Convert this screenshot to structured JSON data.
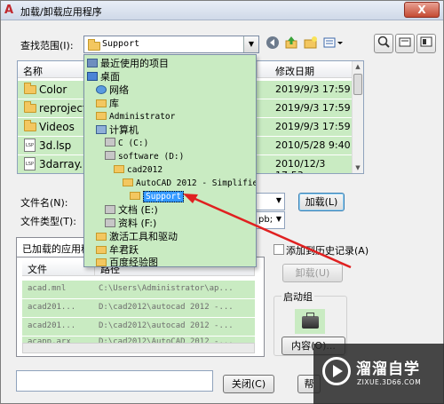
{
  "window": {
    "title": "加载/卸载应用程序",
    "close_glyph": "X"
  },
  "search": {
    "label": "查找范围(I):",
    "value": "Support"
  },
  "filelist": {
    "headers": [
      "名称",
      "修改日期"
    ],
    "rows": [
      {
        "name": "Color",
        "date": "2019/9/3 17:59",
        "type": "folder"
      },
      {
        "name": "reproject",
        "date": "2019/9/3 17:59",
        "type": "folder"
      },
      {
        "name": "Videos",
        "date": "2019/9/3 17:59",
        "type": "folder"
      },
      {
        "name": "3d.lsp",
        "date": "2010/5/28 9:40",
        "type": "lsp"
      },
      {
        "name": "3darray.ls",
        "date": "2010/12/3 17:53",
        "type": "lsp"
      }
    ]
  },
  "dropdown": {
    "items": [
      {
        "label": "最近使用的项目",
        "icon": "recent-icon"
      },
      {
        "label": "桌面",
        "icon": "desktop-icon"
      },
      {
        "label": "网络",
        "icon": "network-icon"
      },
      {
        "label": "库",
        "icon": "library-icon"
      },
      {
        "label": "Administrator",
        "icon": "user-icon"
      },
      {
        "label": "计算机",
        "icon": "computer-icon"
      },
      {
        "label": "C (C:)",
        "icon": "drive-icon"
      },
      {
        "label": "software (D:)",
        "icon": "drive-icon"
      },
      {
        "label": "cad2012",
        "icon": "folder-icon"
      },
      {
        "label": "AutoCAD 2012 - Simplifie",
        "icon": "folder-icon"
      },
      {
        "label": "Support",
        "icon": "folder-icon"
      },
      {
        "label": "文档 (E:)",
        "icon": "drive-icon"
      },
      {
        "label": "资料 (F:)",
        "icon": "drive-icon"
      },
      {
        "label": "激活工具和驱动",
        "icon": "folder-icon"
      },
      {
        "label": "牟君跃",
        "icon": "folder-icon"
      },
      {
        "label": "百度经验图",
        "icon": "folder-icon"
      }
    ]
  },
  "filename": {
    "label": "文件名(N):"
  },
  "filetype": {
    "label": "文件类型(T):",
    "value": "pb;"
  },
  "buttons": {
    "load": "加载(L)",
    "unload": "卸载(U)",
    "close": "关闭(C)",
    "help": "帮",
    "contents": "内容(O)..."
  },
  "tabs": {
    "loaded": "已加载的应用程"
  },
  "loaded_list": {
    "headers": [
      "文件",
      "路径"
    ],
    "rows": [
      {
        "file": "acad.mnl",
        "path": "C:\\Users\\Administrator\\ap..."
      },
      {
        "file": "acad201...",
        "path": "D:\\cad2012\\autocad 2012 -..."
      },
      {
        "file": "acad201...",
        "path": "D:\\cad2012\\autocad 2012 -..."
      },
      {
        "file": "acapp.arx",
        "path": "D:\\cad2012\\AutoCAD 2012 -..."
      }
    ]
  },
  "history": {
    "label": "添加到历史记录(A)"
  },
  "startup": {
    "label": "启动组"
  },
  "watermark": {
    "title": "溜溜自学",
    "subtitle": "ZIXUE.3D66.COM"
  },
  "colors": {
    "highlight": "#c9ebc2",
    "selection": "#3399ff",
    "arrow": "#e02020"
  }
}
